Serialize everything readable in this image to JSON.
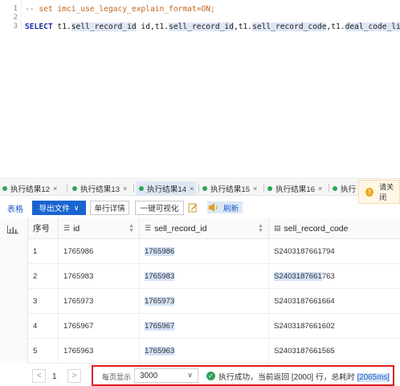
{
  "editor": {
    "lines": [
      {
        "num": "1",
        "comment": "-- set imci_use_legacy_explain_format=ON;"
      },
      {
        "num": "2",
        "text": ""
      },
      {
        "num": "3",
        "keyword": "SELECT",
        "rest_plain": " t1.",
        "hl1": "sell_record_id",
        "mid1": " id,t1.",
        "hl2": "sell_record_id",
        "mid2": ",t1.",
        "hl3": "sell_record_code",
        "mid3": ",t1.",
        "hl4": "deal_code_list"
      }
    ]
  },
  "tabs": [
    {
      "label": "执行结果12",
      "close": "×"
    },
    {
      "label": "执行结果13",
      "close": "×"
    },
    {
      "label": "执行结果14",
      "close": "×",
      "active": true
    },
    {
      "label": "执行结果15",
      "close": "×"
    },
    {
      "label": "执行结果16",
      "close": "×"
    },
    {
      "label": "执行",
      "close": ""
    }
  ],
  "warning": {
    "icon": "!",
    "text": "请关闭"
  },
  "toolbar": {
    "table_label": "表格",
    "export_label": "导出文件",
    "export_chevron": "∨",
    "detail_label": "单行详情",
    "viz_label": "一键可视化",
    "refresh_label": "刷新",
    "icons": [
      "edit-icon",
      "speaker-icon"
    ]
  },
  "grid": {
    "columns": [
      {
        "label": "序号",
        "icon": ""
      },
      {
        "label": "id",
        "icon": "☰"
      },
      {
        "label": "sell_record_id",
        "icon": "☰"
      },
      {
        "label": "sell_record_code",
        "icon": "▤"
      }
    ],
    "sort_glyph_up": "▲",
    "sort_glyph_down": "▼",
    "rows": [
      {
        "idx": "1",
        "id": "1765986",
        "sell_record_id": "1765986",
        "code_hl": "",
        "code": "S2403187661794"
      },
      {
        "idx": "2",
        "id": "1765983",
        "sell_record_id": "1765983",
        "code_hl": "S2403187661",
        "code": "763"
      },
      {
        "idx": "3",
        "id": "1765973",
        "sell_record_id": "1765973",
        "code_hl": "",
        "code": "S2403187661664"
      },
      {
        "idx": "4",
        "id": "1765967",
        "sell_record_id": "1765967",
        "code_hl": "",
        "code": "S2403187661602"
      },
      {
        "idx": "5",
        "id": "1765963",
        "sell_record_id": "1765963",
        "code_hl": "",
        "code": "S2403187661565"
      }
    ]
  },
  "footer": {
    "prev": "<",
    "page": "1",
    "next": ">",
    "per_page_label": "每页显示",
    "per_page_value": "3000",
    "per_page_chevron": "∨",
    "ok_icon": "✓",
    "status_prefix": "执行成功，当前返回 [2000] 行，总耗时 ",
    "status_time": "[2065ms]"
  },
  "colors": {
    "accent": "#1a64d0",
    "success": "#2fa55a",
    "alert_border": "#e01e1e",
    "highlight": "#d4e2f7"
  }
}
